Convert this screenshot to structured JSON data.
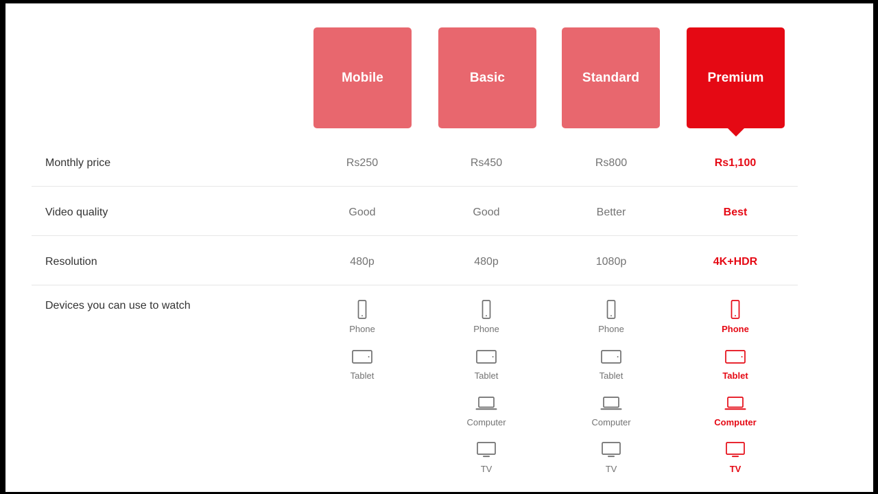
{
  "colors": {
    "accent_red": "#e50914",
    "card_salmon": "#e8676e",
    "label_text": "#333333",
    "value_text": "#737373",
    "divider": "#e6e6e6",
    "page_background": "#ffffff",
    "frame": "#000000"
  },
  "plans": [
    {
      "name": "Mobile",
      "featured": false
    },
    {
      "name": "Basic",
      "featured": false
    },
    {
      "name": "Standard",
      "featured": false
    },
    {
      "name": "Premium",
      "featured": true
    }
  ],
  "rows": [
    {
      "label": "Monthly price",
      "values": [
        "Rs250",
        "Rs450",
        "Rs800",
        "Rs1,100"
      ]
    },
    {
      "label": "Video quality",
      "values": [
        "Good",
        "Good",
        "Better",
        "Best"
      ]
    },
    {
      "label": "Resolution",
      "values": [
        "480p",
        "480p",
        "1080p",
        "4K+HDR"
      ]
    }
  ],
  "devices_row": {
    "label": "Devices you can use to watch",
    "columns": [
      {
        "plan": "Mobile",
        "devices": [
          {
            "icon": "phone-icon",
            "label": "Phone"
          },
          {
            "icon": "tablet-icon",
            "label": "Tablet"
          }
        ]
      },
      {
        "plan": "Basic",
        "devices": [
          {
            "icon": "phone-icon",
            "label": "Phone"
          },
          {
            "icon": "tablet-icon",
            "label": "Tablet"
          },
          {
            "icon": "computer-icon",
            "label": "Computer"
          },
          {
            "icon": "tv-icon",
            "label": "TV"
          }
        ]
      },
      {
        "plan": "Standard",
        "devices": [
          {
            "icon": "phone-icon",
            "label": "Phone"
          },
          {
            "icon": "tablet-icon",
            "label": "Tablet"
          },
          {
            "icon": "computer-icon",
            "label": "Computer"
          },
          {
            "icon": "tv-icon",
            "label": "TV"
          }
        ]
      },
      {
        "plan": "Premium",
        "devices": [
          {
            "icon": "phone-icon",
            "label": "Phone"
          },
          {
            "icon": "tablet-icon",
            "label": "Tablet"
          },
          {
            "icon": "computer-icon",
            "label": "Computer"
          },
          {
            "icon": "tv-icon",
            "label": "TV"
          }
        ]
      }
    ]
  }
}
